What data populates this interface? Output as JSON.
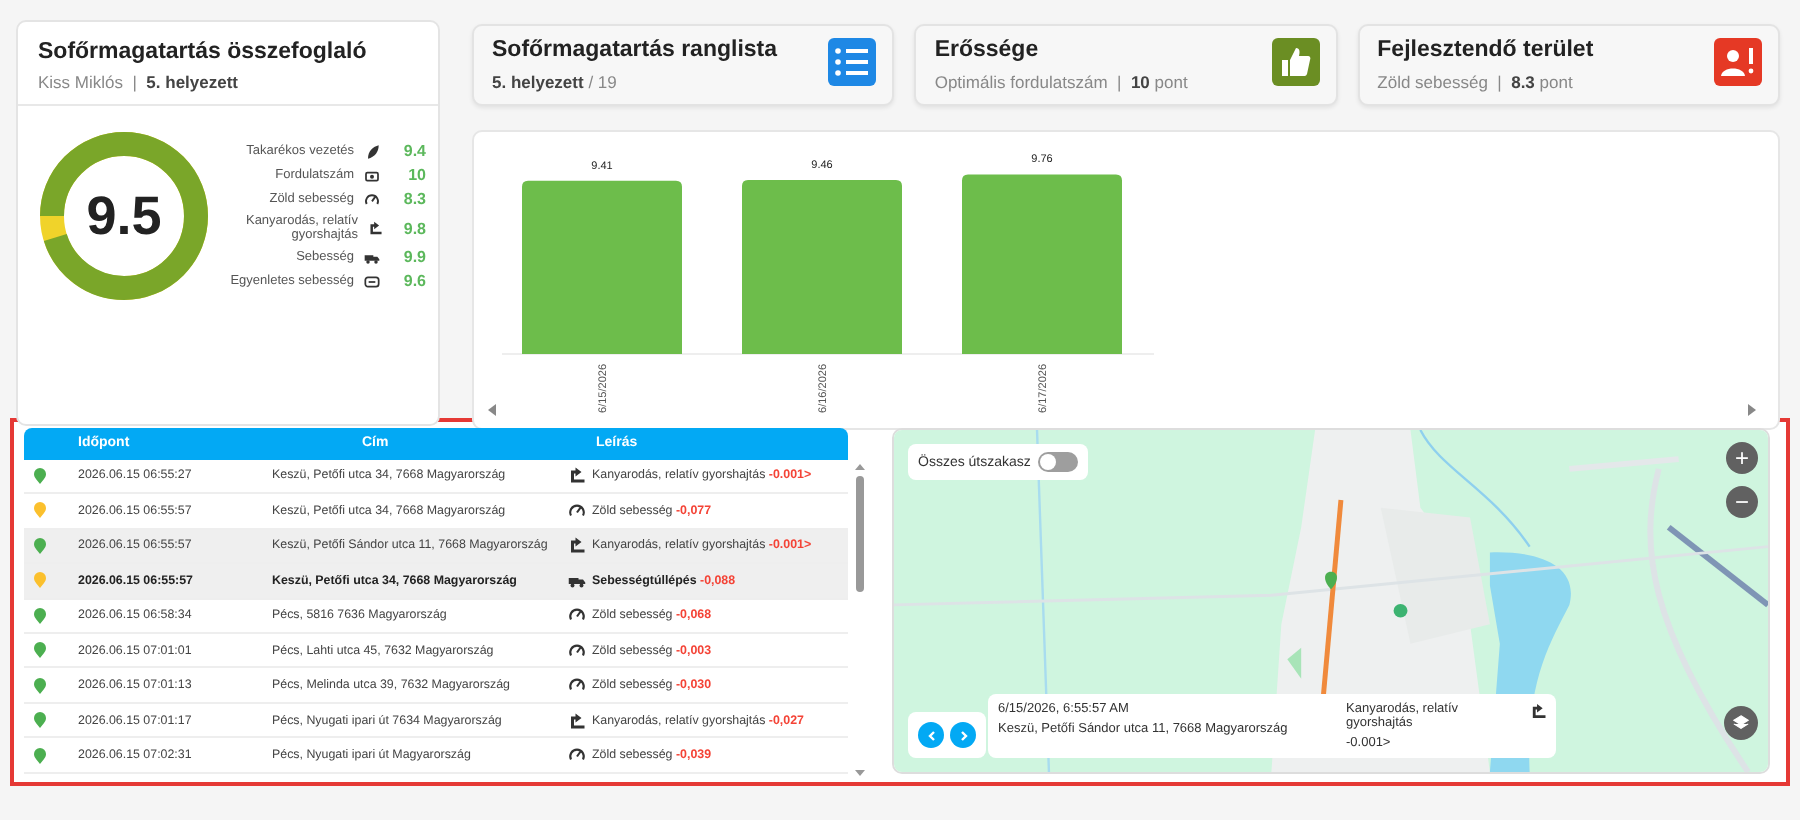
{
  "summary": {
    "title": "Sofőrmagatartás összefoglaló",
    "subtitle": "Kiss Miklós  |  **5. helyezett**",
    "score": "9.5",
    "level": 0.95,
    "metrics": [
      {
        "label": "Takarékos vezetés",
        "kind": "leaf",
        "value": "9.4"
      },
      {
        "label": "Fordulatszám",
        "kind": "engine",
        "value": "10"
      },
      {
        "label": "Zöld sebesség",
        "kind": "gauge",
        "value": "8.3"
      },
      {
        "label": "Kanyarodás, relatív gyorshajtás",
        "kind": "turn",
        "value": "9.8"
      },
      {
        "label": "Sebesség",
        "kind": "truck",
        "value": "9.9"
      },
      {
        "label": "Egyenletes sebesség",
        "kind": "cruise",
        "value": "9.6"
      }
    ]
  },
  "cards": [
    {
      "kind": "rank",
      "title": "Sofőrmagatartás ranglista",
      "subtitle": "**5. helyezett** / 19"
    },
    {
      "kind": "strength",
      "title": "Erőssége",
      "subtitle": "Optimális fordulatszám  |  **10** pont"
    },
    {
      "kind": "weakness",
      "title": "Fejlesztendő terület",
      "subtitle": "Zöld sebesség  |  **8.3** pont"
    }
  ],
  "chart": {
    "chart_data": {
      "type": "bar",
      "categories": [
        "6/15/2026",
        "6/16/2026",
        "6/17/2026"
      ],
      "series": [
        {
          "color": "#6dbd4b",
          "values": [
            9.41,
            9.46,
            9.76
          ]
        }
      ],
      "ylim": [
        0,
        10
      ],
      "data_labels": true
    }
  },
  "table": {
    "columns": [
      "Időpont",
      "Cím",
      "Leírás"
    ],
    "rows": [
      {
        "color": "#4caf50",
        "selected": false,
        "hovered": false,
        "time": "2026.06.15 06:55:27",
        "address": "Keszü, Petőfi utca 34, 7668 Magyarország",
        "kind": "turn",
        "description": "Kanyarodás, relatív gyorshajtás",
        "delta": "-0.001>"
      },
      {
        "color": "#fbc02d",
        "selected": false,
        "hovered": false,
        "time": "2026.06.15 06:55:57",
        "address": "Keszü, Petőfi utca 34, 7668 Magyarország",
        "kind": "gauge",
        "description": "Zöld sebesség",
        "delta": "-0,077"
      },
      {
        "color": "#4caf50",
        "selected": true,
        "hovered": false,
        "time": "2026.06.15 06:55:57",
        "address": "Keszü, Petőfi Sándor utca 11, 7668 Magyarország",
        "kind": "turn",
        "description": "Kanyarodás, relatív gyorshajtás",
        "delta": "-0.001>"
      },
      {
        "color": "#fbc02d",
        "selected": true,
        "hovered": true,
        "time": "2026.06.15 06:55:57",
        "address": "Keszü, Petőfi utca 34, 7668 Magyarország",
        "kind": "truck",
        "description": "Sebességtúllépés",
        "delta": "-0,088"
      },
      {
        "color": "#4caf50",
        "selected": false,
        "hovered": false,
        "time": "2026.06.15 06:58:34",
        "address": "Pécs, 5816 7636 Magyarország",
        "kind": "gauge",
        "description": "Zöld sebesség",
        "delta": "-0,068"
      },
      {
        "color": "#4caf50",
        "selected": false,
        "hovered": false,
        "time": "2026.06.15 07:01:01",
        "address": "Pécs, Lahti utca 45, 7632 Magyarország",
        "kind": "gauge",
        "description": "Zöld sebesség",
        "delta": "-0,003"
      },
      {
        "color": "#4caf50",
        "selected": false,
        "hovered": false,
        "time": "2026.06.15 07:01:13",
        "address": "Pécs, Melinda utca 39, 7632 Magyarország",
        "kind": "gauge",
        "description": "Zöld sebesség",
        "delta": "-0,030"
      },
      {
        "color": "#4caf50",
        "selected": false,
        "hovered": false,
        "time": "2026.06.15 07:01:17",
        "address": "Pécs, Nyugati ipari út 7634 Magyarország",
        "kind": "turn",
        "description": "Kanyarodás, relatív gyorshajtás",
        "delta": "-0,027"
      },
      {
        "color": "#4caf50",
        "selected": false,
        "hovered": false,
        "time": "2026.06.15 07:02:31",
        "address": "Pécs, Nyugati ipari út Magyarország",
        "kind": "gauge",
        "description": "Zöld sebesség",
        "delta": "-0,039"
      }
    ]
  },
  "map": {
    "kind": "picture",
    "toggle": {
      "label": "Összes útszakasz",
      "on": false
    },
    "zoom_in": "+",
    "zoom_out": "−",
    "info": {
      "time": "6/15/2026, 6:55:57 AM",
      "address": "Keszü, Petőfi Sándor utca 11, 7668 Magyarország",
      "kind": "turn",
      "description": "Kanyarodás, relatív gyorshajtás",
      "delta": "-0.001>"
    }
  }
}
